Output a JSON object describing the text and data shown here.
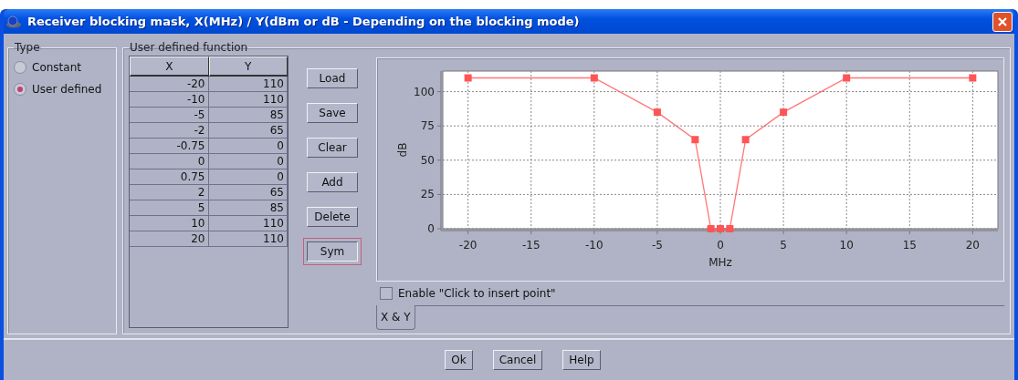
{
  "window": {
    "title": "Receiver blocking mask, X(MHz) / Y(dBm or dB - Depending on the blocking mode)"
  },
  "type_group": {
    "title": "Type",
    "options": [
      {
        "label": "Constant",
        "selected": false
      },
      {
        "label": "User defined",
        "selected": true
      }
    ]
  },
  "function_group": {
    "title": "User defined function",
    "table": {
      "columns": [
        "X",
        "Y"
      ],
      "rows": [
        [
          "-20",
          "110"
        ],
        [
          "-10",
          "110"
        ],
        [
          "-5",
          "85"
        ],
        [
          "-2",
          "65"
        ],
        [
          "-0.75",
          "0"
        ],
        [
          "0",
          "0"
        ],
        [
          "0.75",
          "0"
        ],
        [
          "2",
          "65"
        ],
        [
          "5",
          "85"
        ],
        [
          "10",
          "110"
        ],
        [
          "20",
          "110"
        ]
      ]
    },
    "buttons": [
      {
        "label": "Load",
        "focused": false
      },
      {
        "label": "Save",
        "focused": false
      },
      {
        "label": "Clear",
        "focused": false
      },
      {
        "label": "Add",
        "focused": false
      },
      {
        "label": "Delete",
        "focused": false
      },
      {
        "label": "Sym",
        "focused": true
      }
    ],
    "chart_data": {
      "type": "line",
      "xlabel": "MHz",
      "ylabel": "dB",
      "x": [
        -20,
        -10,
        -5,
        -2,
        -0.75,
        0,
        0.75,
        2,
        5,
        10,
        20
      ],
      "series": [
        {
          "color": "#ff5555",
          "marker": "square",
          "values": [
            110,
            110,
            85,
            65,
            0,
            0,
            0,
            65,
            85,
            110,
            110
          ]
        }
      ],
      "grid": true,
      "xlim": [
        -22,
        22
      ],
      "ylim": [
        0,
        115
      ],
      "xticks": [
        -20,
        -15,
        -10,
        -5,
        0,
        5,
        10,
        15,
        20
      ],
      "yticks": [
        0,
        25,
        50,
        75,
        100
      ]
    },
    "click_insert": {
      "label": "Enable \"Click to insert point\"",
      "checked": false
    },
    "tabs": [
      {
        "label": "X & Y",
        "selected": true
      }
    ]
  },
  "footer_buttons": [
    "Ok",
    "Cancel",
    "Help"
  ]
}
